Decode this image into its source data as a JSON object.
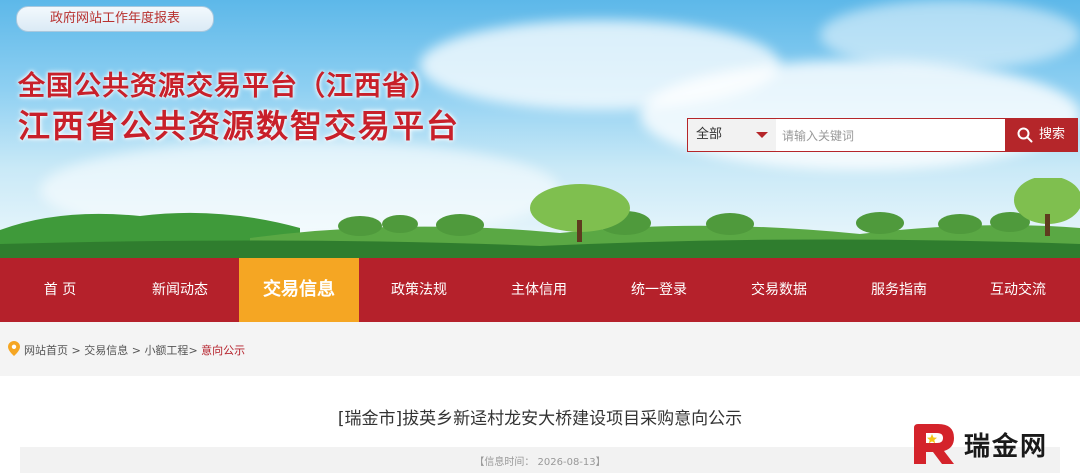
{
  "top_pill": "政府网站工作年度报表",
  "header": {
    "title_line1": "全国公共资源交易平台（江西省）",
    "title_line2": "江西省公共资源数智交易平台"
  },
  "search": {
    "scope": "全部",
    "placeholder": "请输入关键词",
    "button": "搜索"
  },
  "nav": {
    "items": [
      {
        "label": "首 页"
      },
      {
        "label": "新闻动态"
      },
      {
        "label": "交易信息",
        "active": true
      },
      {
        "label": "政策法规"
      },
      {
        "label": "主体信用"
      },
      {
        "label": "统一登录"
      },
      {
        "label": "交易数据"
      },
      {
        "label": "服务指南"
      },
      {
        "label": "互动交流"
      }
    ]
  },
  "breadcrumb": {
    "home": "网站首页",
    "sep1": " > ",
    "level1": "交易信息",
    "sep2": " > ",
    "level2": "小额工程",
    "sep3": "> ",
    "current": "意向公示"
  },
  "notice": {
    "title": "[瑞金市]拔英乡新迳村龙安大桥建设项目采购意向公示",
    "meta": "【信息时间：   2026-08-13】"
  },
  "watermark": {
    "text": "瑞金网"
  },
  "colors": {
    "brand_red": "#b5212b",
    "active_orange": "#f5a623",
    "title_red": "#c8202a"
  }
}
